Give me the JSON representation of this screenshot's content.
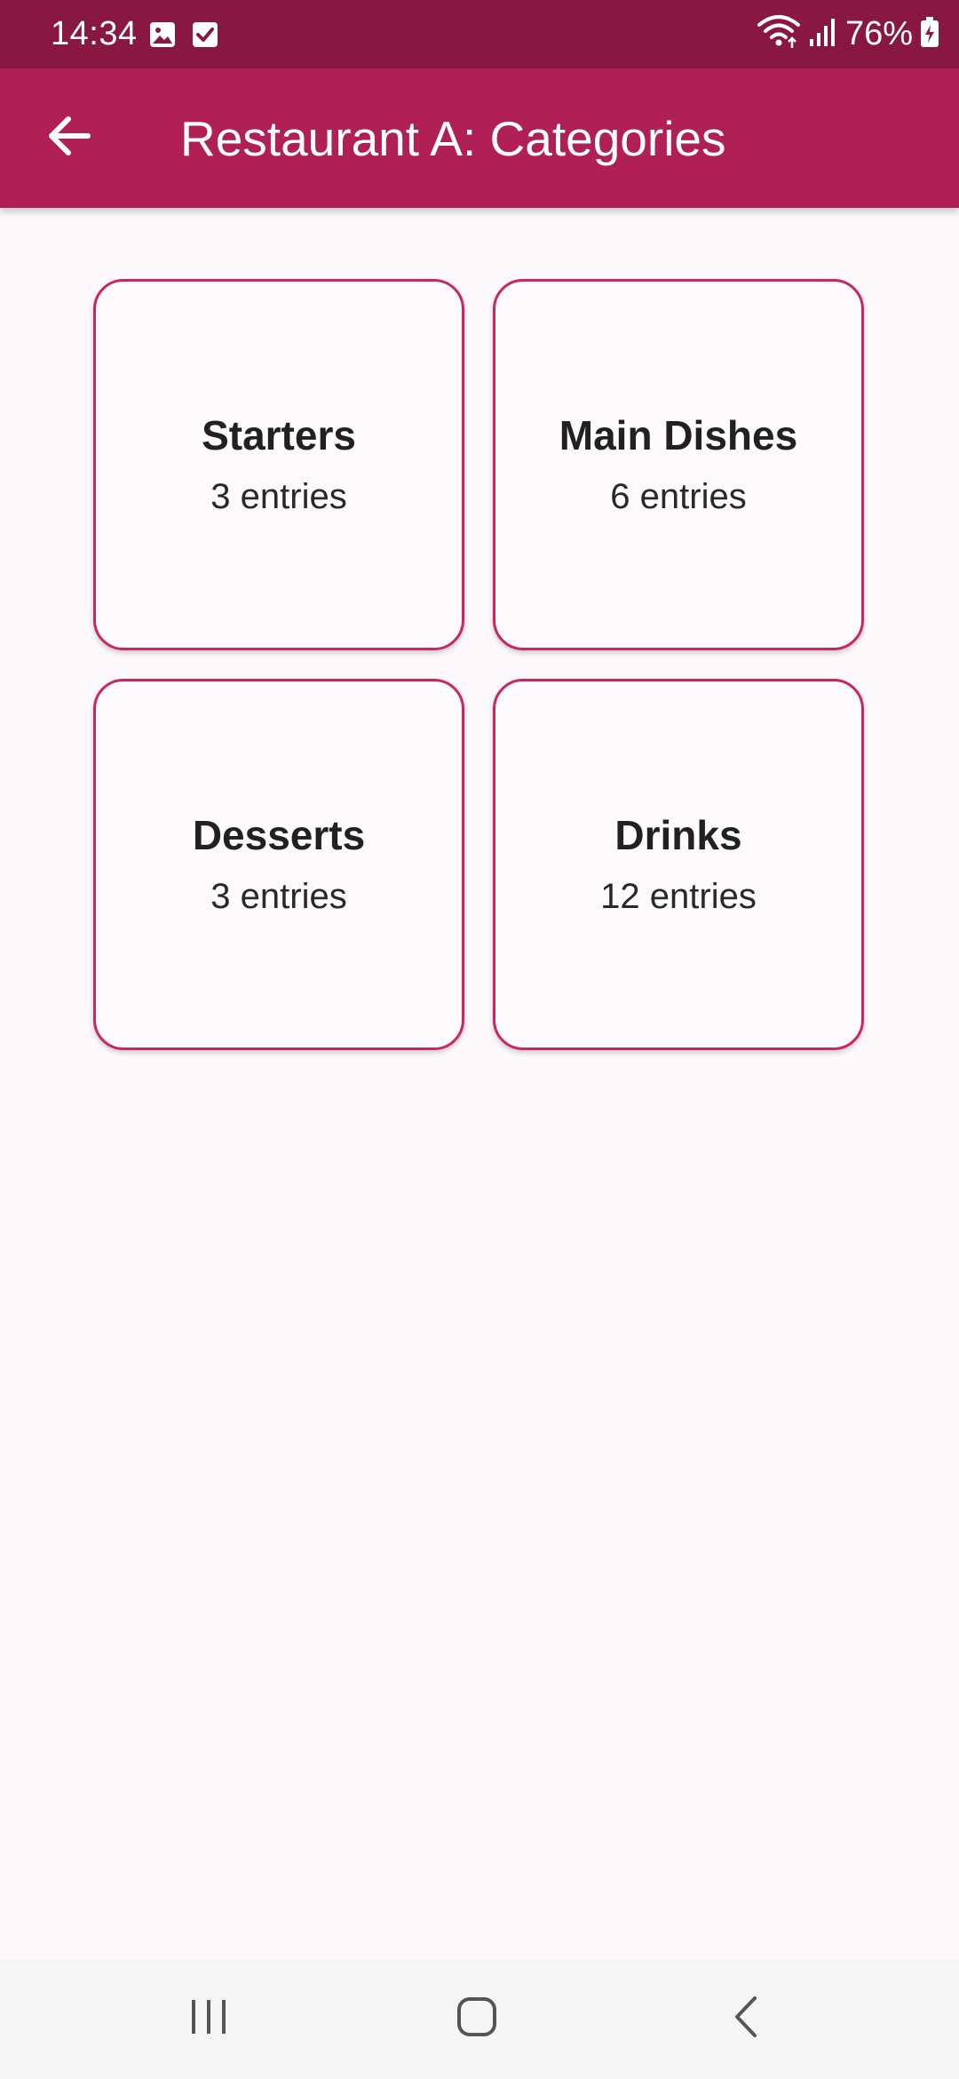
{
  "status_bar": {
    "time": "14:34",
    "battery_percent": "76%",
    "icons": [
      "image-icon",
      "checkbox-icon",
      "wifi-icon",
      "signal-icon",
      "battery-charging-icon"
    ]
  },
  "app_bar": {
    "title": "Restaurant A: Categories",
    "back_icon": "arrow-back-icon"
  },
  "categories": [
    {
      "name": "Starters",
      "count": "3 entries"
    },
    {
      "name": "Main Dishes",
      "count": "6 entries"
    },
    {
      "name": "Desserts",
      "count": "3 entries"
    },
    {
      "name": "Drinks",
      "count": "12 entries"
    }
  ],
  "nav_bar": {
    "icons": [
      "recent-apps-icon",
      "home-icon",
      "back-icon"
    ]
  },
  "colors": {
    "status_bar": "#881841",
    "app_bar": "#b11f57",
    "card_border": "#c8285f",
    "background": "#fdf8fc"
  }
}
